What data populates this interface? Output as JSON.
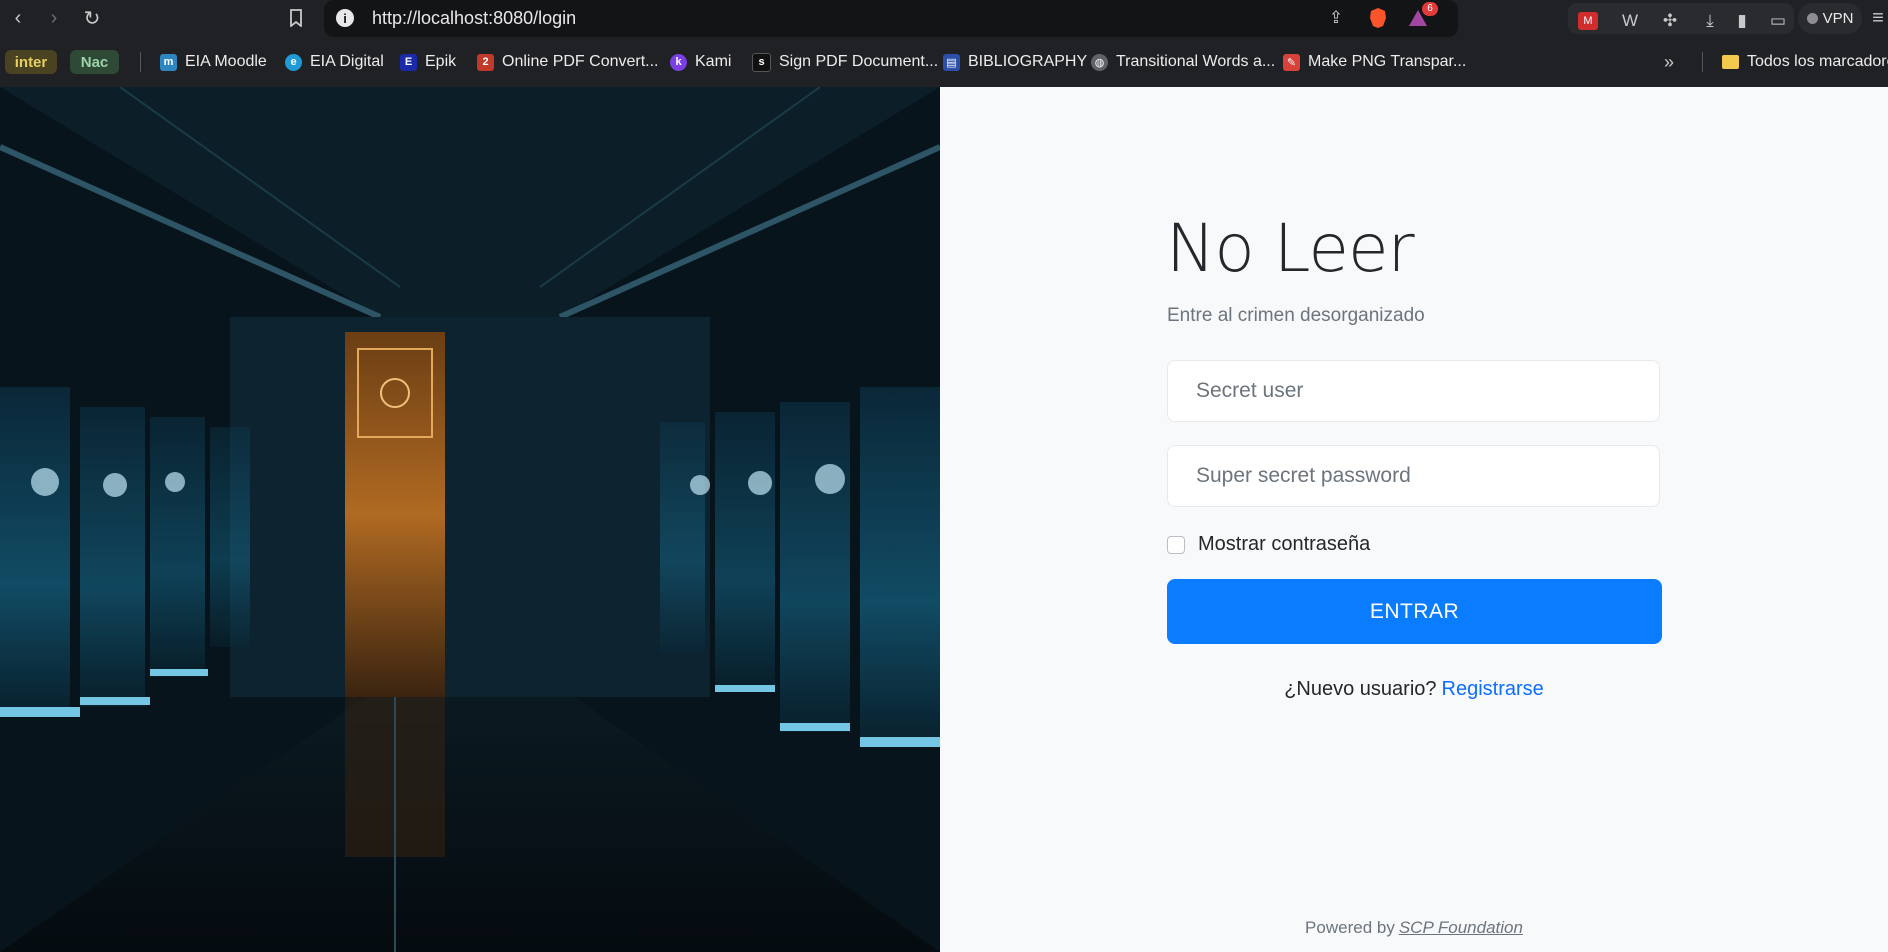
{
  "browser": {
    "url": "http://localhost:8080/login",
    "notification_count": "6",
    "vpn_label": "VPN"
  },
  "bookmarks": {
    "tags": [
      {
        "label": "inter",
        "color": "#b8a241"
      },
      {
        "label": "Nac",
        "color": "#5d8e66"
      }
    ],
    "items": [
      {
        "label": "EIA Moodle",
        "icon": "moodle-icon",
        "color": "#2e86c1"
      },
      {
        "label": "EIA Digital",
        "icon": "eia-digital-icon",
        "color": "#1f9ad6"
      },
      {
        "label": "Epik",
        "icon": "epik-icon",
        "color": "#1a2aa8"
      },
      {
        "label": "Online PDF Convert...",
        "icon": "pdf-convert-icon",
        "color": "#c0392b"
      },
      {
        "label": "Kami",
        "icon": "kami-icon",
        "color": "#7b3fe4"
      },
      {
        "label": "Sign PDF Document...",
        "icon": "sign-pdf-icon",
        "color": "#111111"
      },
      {
        "label": "BIBLIOGRAPHY",
        "icon": "bibliography-icon",
        "color": "#2c4fa8"
      },
      {
        "label": "Transitional Words a...",
        "icon": "globe-icon",
        "color": "#5f6368"
      },
      {
        "label": "Make PNG Transpar...",
        "icon": "png-tool-icon",
        "color": "#d9423a"
      }
    ],
    "more": "»",
    "folder_label": "Todos los marcadores"
  },
  "login": {
    "title": "No Leer",
    "subtitle": "Entre al crimen desorganizado",
    "user_placeholder": "Secret user",
    "password_placeholder": "Super secret password",
    "show_password_label": "Mostrar contraseña",
    "submit_label": "ENTRAR",
    "register_prompt": "¿Nuevo usuario?",
    "register_link": "Registrarse",
    "powered_by": "Powered by",
    "powered_link": "SCP Foundation"
  },
  "colors": {
    "primary": "#0a7cff",
    "link": "#0d6efd",
    "panel_bg": "#f8f9fa"
  }
}
